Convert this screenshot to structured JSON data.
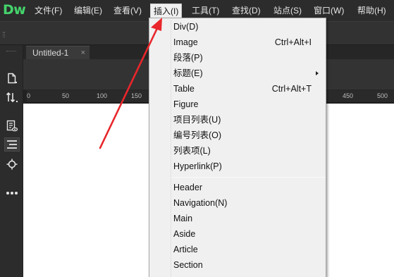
{
  "app": {
    "logo": "Dw",
    "brand_color": "#45d46c"
  },
  "menubar": {
    "items": [
      {
        "label": "文件(F)"
      },
      {
        "label": "编辑(E)"
      },
      {
        "label": "查看(V)"
      },
      {
        "label": "插入(I)"
      },
      {
        "label": "工具(T)"
      },
      {
        "label": "查找(D)"
      },
      {
        "label": "站点(S)"
      },
      {
        "label": "窗口(W)"
      },
      {
        "label": "帮助(H)"
      }
    ],
    "active_index": 3
  },
  "document": {
    "tab_label": "Untitled-1",
    "close_glyph": "×"
  },
  "left_tools": [
    {
      "icon": "new-file-icon"
    },
    {
      "icon": "sort-arrows-icon"
    },
    {
      "icon": "preview-icon"
    },
    {
      "icon": "dom-panel-icon",
      "selected": true
    },
    {
      "icon": "target-icon"
    },
    {
      "icon": "more-dots-icon"
    }
  ],
  "ruler": {
    "labels": [
      "0",
      "50",
      "100",
      "150",
      "450",
      "500"
    ]
  },
  "insert_menu": {
    "items": [
      {
        "label": "Div(D)",
        "shortcut": ""
      },
      {
        "label": "Image",
        "shortcut": "Ctrl+Alt+I"
      },
      {
        "label": "段落(P)",
        "shortcut": ""
      },
      {
        "label": "标题(E)",
        "shortcut": "",
        "has_submenu": true
      },
      {
        "label": "Table",
        "shortcut": "Ctrl+Alt+T"
      },
      {
        "label": "Figure",
        "shortcut": ""
      },
      {
        "label": "项目列表(U)",
        "shortcut": ""
      },
      {
        "label": "编号列表(O)",
        "shortcut": ""
      },
      {
        "label": "列表项(L)",
        "shortcut": ""
      },
      {
        "label": "Hyperlink(P)",
        "shortcut": ""
      },
      {
        "label": "Header",
        "shortcut": ""
      },
      {
        "label": "Navigation(N)",
        "shortcut": ""
      },
      {
        "label": "Main",
        "shortcut": ""
      },
      {
        "label": "Aside",
        "shortcut": ""
      },
      {
        "label": "Article",
        "shortcut": ""
      },
      {
        "label": "Section",
        "shortcut": ""
      }
    ]
  },
  "annotation": {
    "arrow_color": "#e8262b"
  }
}
